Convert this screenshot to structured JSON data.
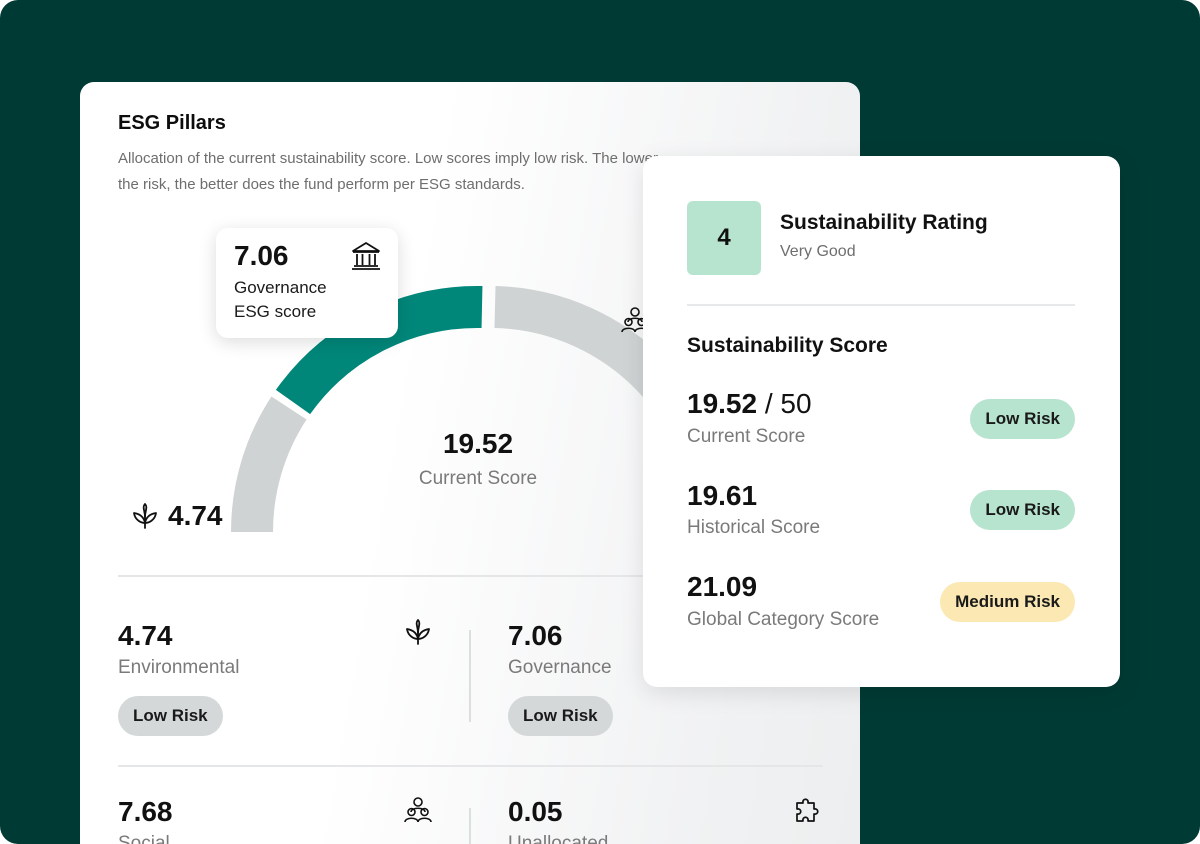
{
  "colors": {
    "background": "#003a34",
    "accent": "#00877a",
    "gauge_track": "#cfd3d4",
    "rating_badge": "#b6e4ce",
    "low_risk_green": "#b6e4ce",
    "low_risk_gray": "#d4d8d9",
    "medium_risk": "#fbe8b3"
  },
  "esg_pillars": {
    "title": "ESG Pillars",
    "description": "Allocation of the current sustainability score. Low scores imply low risk. The lower the risk, the better does the fund perform per ESG standards.",
    "gauge": {
      "score": "19.52",
      "score_label": "Current Score",
      "left_value": "4.74",
      "left_icon": "leaf-icon",
      "right_icon": "people-icon",
      "tooltip": {
        "value": "7.06",
        "label": "Governance ESG score",
        "icon": "bank-icon"
      }
    },
    "pillars": [
      {
        "value": "4.74",
        "name": "Environmental",
        "risk": "Low Risk",
        "icon": "leaf-icon"
      },
      {
        "value": "7.06",
        "name": "Governance",
        "risk": "Low Risk",
        "icon": "bank-icon"
      },
      {
        "value": "7.68",
        "name": "Social",
        "icon": "people-icon"
      },
      {
        "value": "0.05",
        "name": "Unallocated",
        "icon": "puzzle-icon"
      }
    ]
  },
  "sustainability": {
    "rating_value": "4",
    "rating_title": "Sustainability Rating",
    "rating_label": "Very Good",
    "score_heading": "Sustainability Score",
    "rows": [
      {
        "value": "19.52",
        "out_of": "/ 50",
        "label": "Current Score",
        "risk": "Low Risk"
      },
      {
        "value": "19.61",
        "label": "Historical Score",
        "risk": "Low Risk"
      },
      {
        "value": "21.09",
        "label": "Global Category Score",
        "risk": "Medium Risk"
      }
    ]
  }
}
